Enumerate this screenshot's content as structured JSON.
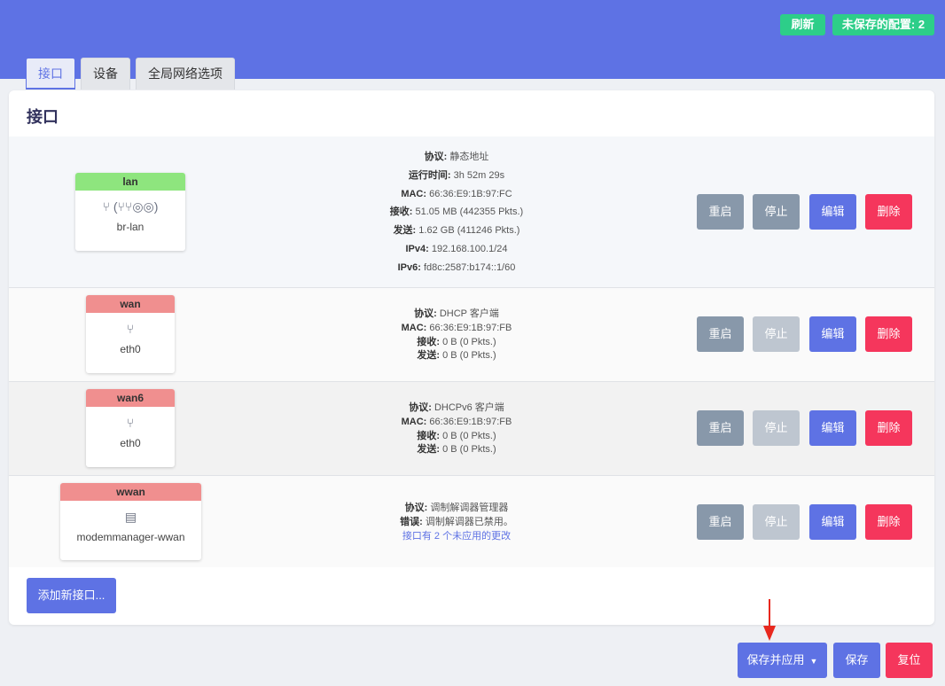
{
  "header": {
    "refresh_label": "刷新",
    "unsaved_label": "未保存的配置: 2"
  },
  "tabs": [
    {
      "label": "接口"
    },
    {
      "label": "设备"
    },
    {
      "label": "全局网络选项"
    }
  ],
  "card": {
    "title": "接口"
  },
  "interfaces": [
    {
      "name": "lan",
      "header_color": "#8ee57e",
      "device": "br-lan",
      "icons": "⑂ (⑂⑂◎◎)",
      "status": [
        {
          "key": "协议:",
          "value": "静态地址"
        },
        {
          "key": "运行时间:",
          "value": "3h 52m 29s"
        },
        {
          "key": "MAC:",
          "value": "66:36:E9:1B:97:FC"
        },
        {
          "key": "接收:",
          "value": "51.05 MB (442355 Pkts.)"
        },
        {
          "key": "发送:",
          "value": "1.62 GB (411246 Pkts.)"
        },
        {
          "key": "IPv4:",
          "value": "192.168.100.1/24"
        },
        {
          "key": "IPv6:",
          "value": "fd8c:2587:b174::1/60"
        }
      ]
    },
    {
      "name": "wan",
      "header_color": "#f08f8f",
      "device": "eth0",
      "icons": "⑂",
      "status": [
        {
          "key": "协议:",
          "value": "DHCP 客户端"
        },
        {
          "key": "MAC:",
          "value": "66:36:E9:1B:97:FB"
        },
        {
          "key": "接收:",
          "value": "0 B (0 Pkts.)"
        },
        {
          "key": "发送:",
          "value": "0 B (0 Pkts.)"
        }
      ]
    },
    {
      "name": "wan6",
      "header_color": "#f08f8f",
      "device": "eth0",
      "icons": "⑂",
      "status": [
        {
          "key": "协议:",
          "value": "DHCPv6 客户端"
        },
        {
          "key": "MAC:",
          "value": "66:36:E9:1B:97:FB"
        },
        {
          "key": "接收:",
          "value": "0 B (0 Pkts.)"
        },
        {
          "key": "发送:",
          "value": "0 B (0 Pkts.)"
        }
      ]
    },
    {
      "name": "wwan",
      "header_color": "#f08f8f",
      "device": "modemmanager-wwan",
      "icons": "▤",
      "status": [
        {
          "key": "协议:",
          "value": "调制解调器管理器"
        },
        {
          "key": "错误:",
          "value": "调制解调器已禁用。"
        }
      ],
      "note": "接口有 2 个未应用的更改"
    }
  ],
  "row_buttons": {
    "restart": "重启",
    "stop": "停止",
    "edit": "编辑",
    "delete": "删除"
  },
  "add_label": "添加新接口...",
  "footer": {
    "save_apply": "保存并应用",
    "save": "保存",
    "reset": "复位"
  },
  "colors": {
    "accent": "#5e72e4",
    "success": "#2dce89",
    "danger": "#f5365c",
    "neutral": "#8898aa"
  }
}
